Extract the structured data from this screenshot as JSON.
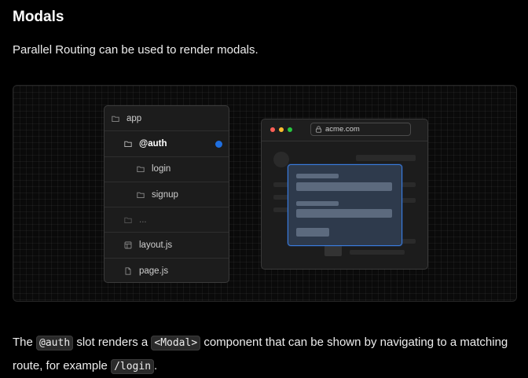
{
  "heading": "Modals",
  "intro": "Parallel Routing can be used to render modals.",
  "file_tree": {
    "rows": [
      {
        "label": "app",
        "icon": "folder-icon"
      },
      {
        "label": "@auth",
        "icon": "folder-icon",
        "active_color": "#1f6fe0"
      },
      {
        "label": "login",
        "icon": "folder-icon"
      },
      {
        "label": "signup",
        "icon": "folder-icon"
      },
      {
        "label": "...",
        "icon": "folder-icon"
      },
      {
        "label": "layout.js",
        "icon": "layout-file-icon"
      },
      {
        "label": "page.js",
        "icon": "file-icon"
      }
    ]
  },
  "browser": {
    "url": "acme.com",
    "traffic_lights": [
      "#ff5f57",
      "#febc2e",
      "#28c840"
    ]
  },
  "description": {
    "t1": "The ",
    "c1": "@auth",
    "t2": " slot renders a ",
    "c2": "<Modal>",
    "t3": " component that can be shown by navigating to a matching route, for example ",
    "c3": "/login",
    "t4": "."
  },
  "colors": {
    "accent": "#1f6fe0",
    "modal_border": "#3a7cdc",
    "background": "#000000"
  }
}
